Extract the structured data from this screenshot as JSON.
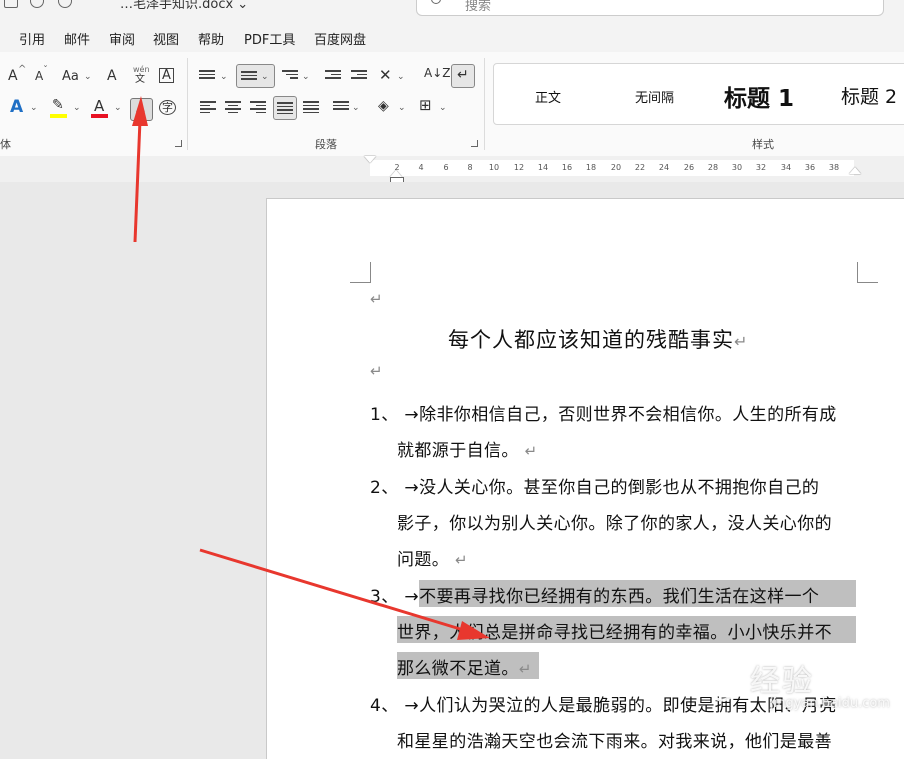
{
  "titlebar": {
    "doc_name": "…毛泽手知识.docx ⌄",
    "search_placeholder": "搜索"
  },
  "menu": [
    "引用",
    "邮件",
    "审阅",
    "视图",
    "帮助",
    "PDF工具",
    "百度网盘"
  ],
  "ribbon": {
    "font": {
      "grow": "A",
      "shrink": "A",
      "case": "Aa",
      "clear": "A",
      "phonetic_top": "wén",
      "phonetic_bottom": "文",
      "border": "A",
      "effects": "A",
      "highlight": "A",
      "font_color": "A",
      "char_shading": "A",
      "enclose": "字",
      "label": "体"
    },
    "paragraph": {
      "label": "段落",
      "sort": "A↓Z",
      "pilcrow": "↵"
    },
    "styles": {
      "label": "样式",
      "items": [
        "正文",
        "无间隔",
        "标题 1",
        "标题 2"
      ]
    },
    "colors": {
      "highlight_bar": "#ffff00",
      "font_color_bar": "#e81123"
    }
  },
  "ruler": [
    "2",
    "4",
    "6",
    "8",
    "10",
    "12",
    "14",
    "16",
    "18",
    "20",
    "22",
    "24",
    "26",
    "28",
    "30",
    "32",
    "34",
    "36",
    "38"
  ],
  "document": {
    "title": "每个人都应该知道的残酷事实",
    "pilcrow": "↵",
    "lines": [
      "1、 →除非你相信自己，否则世界不会相信你。人生的所有成",
      "就都源于自信。",
      "2、 →没人关心你。甚至你自己的倒影也从不拥抱你自己的",
      "影子，你以为别人关心你。除了你的家人，没人关心你的",
      "问题。",
      "3、 →不要再寻找你已经拥有的东西。我们生活在这样一个",
      "世界，人们总是拼命寻找已经拥有的幸福。小小快乐并不",
      "那么微不足道。",
      "4、 →人们认为哭泣的人是最脆弱的。即使是拥有太阳、月亮",
      "和星星的浩瀚天空也会流下雨来。对我来说，他们是最善"
    ],
    "shading_color": "#bfbfbf"
  },
  "annotations": {
    "arrow_color": "#e8372e"
  },
  "watermark": {
    "text": "经验",
    "url": "jingyan.baidu.com"
  }
}
